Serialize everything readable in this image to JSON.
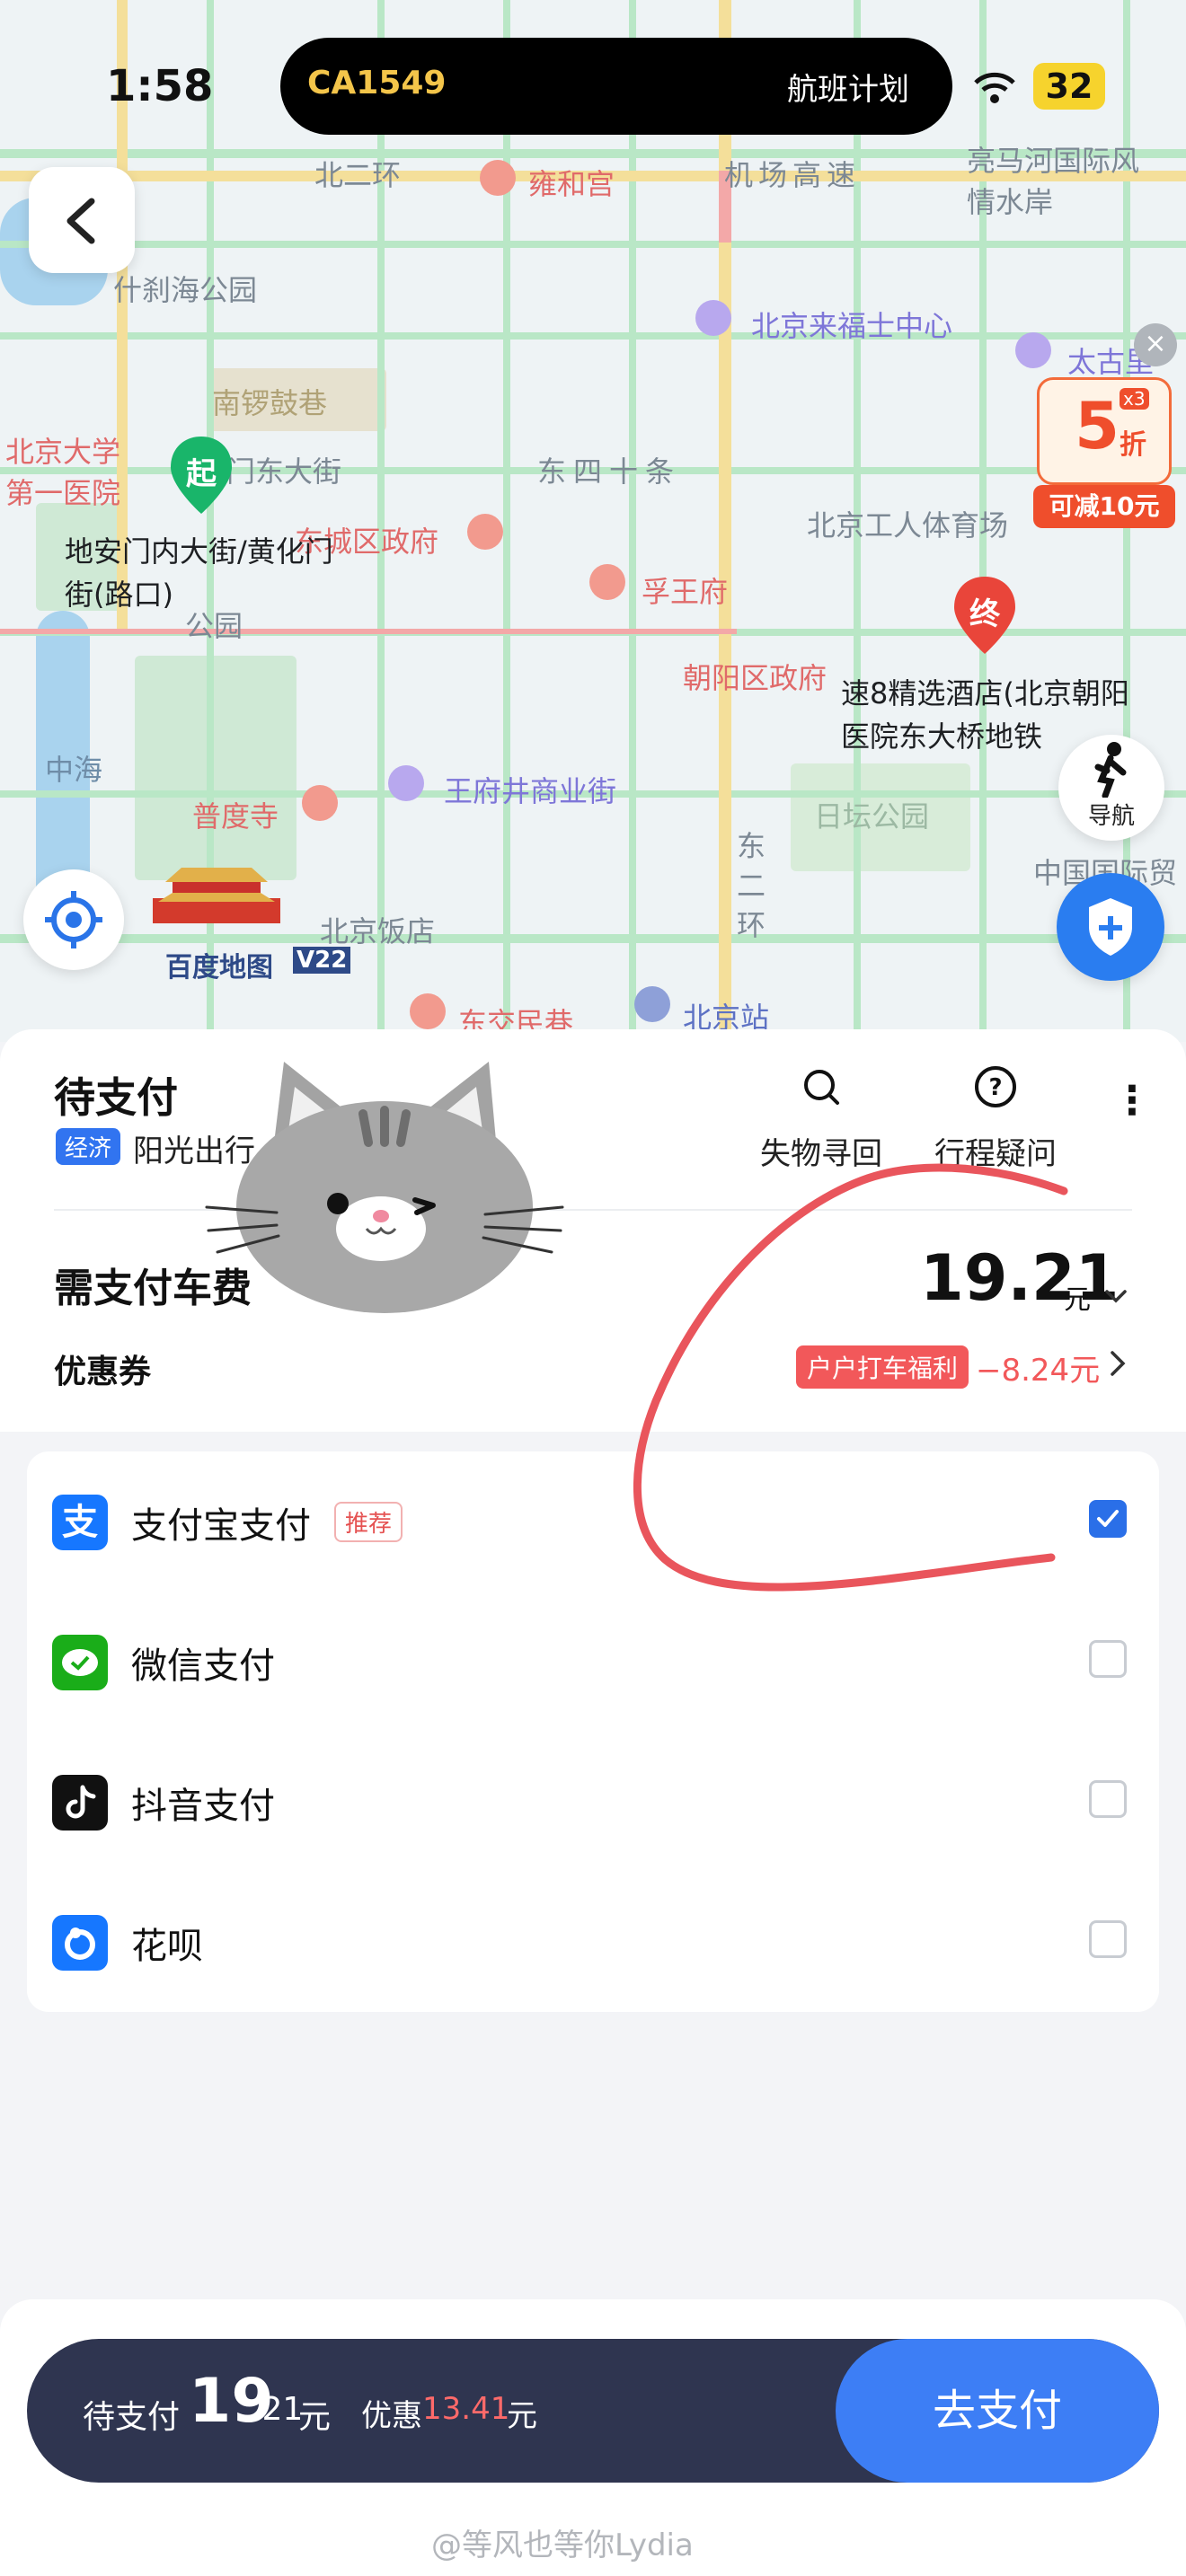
{
  "status_bar": {
    "time": "1:58",
    "island": {
      "flight_code": "CA1549",
      "flight_plan": "航班计划"
    },
    "battery": "32"
  },
  "map": {
    "labels": {
      "n2ring": "北二环",
      "yonghegong": "雍和宫",
      "airport_exp": "机场高速",
      "liangmahe": "亮马河国际风情水岸",
      "shichahai": "什刹海公园",
      "laifushi": "北京来福士中心",
      "taigu": "太古里",
      "nanluoguxiang": "南锣鼓巷",
      "pku_hospital": "北京大学第一医院",
      "dmen_east": "门东大街",
      "dongsi": "东四十条",
      "workers_stadium": "北京工人体育场",
      "dongcheng_gov": "东城区政府",
      "fuwangfu": "孚王府",
      "chaoyang_gov": "朝阳区政府",
      "park_label": "公园",
      "zhonghai": "中海",
      "putuo": "普度寺",
      "wangfujing": "王府井商业街",
      "ritan": "日坛公园",
      "e2ring": "东二环",
      "bj_hotel": "北京饭店",
      "dongjiaominxiang": "东交民巷",
      "bj_station": "北京站",
      "china_intl": "中国国际贸",
      "brand": "百度地图",
      "brand_ver": "V22",
      "promo_discount": "5",
      "promo_unit": "折",
      "promo_mult": "x3",
      "promo_save": "可减10元",
      "close": "×"
    },
    "start_badge": "起",
    "start_label": "地安门内大街/黄化门街(路口)",
    "end_badge": "终",
    "end_label": "速8精选酒店(北京朝阳医院东大桥地铁",
    "nav_label": "导航"
  },
  "order": {
    "status": "待支付",
    "ride_type": "经济",
    "provider": "阳光出行",
    "actions": [
      {
        "label": "失物寻回",
        "icon": "search-icon"
      },
      {
        "label": "行程疑问",
        "icon": "question-icon"
      }
    ],
    "more": "⋮",
    "fare_label": "需支付车费",
    "fare_amount": "19.21",
    "fare_unit": "元",
    "coupon_label": "优惠券",
    "coupon_tag": "户户打车福利",
    "coupon_value": "−8.24元"
  },
  "payment_methods": [
    {
      "label": "支付宝支付",
      "badge": "推荐",
      "checked": true,
      "icon": "alipay-icon",
      "color": "#1677ff"
    },
    {
      "label": "微信支付",
      "checked": false,
      "icon": "wechat-pay-icon",
      "color": "#1aad19"
    },
    {
      "label": "抖音支付",
      "checked": false,
      "icon": "douyin-pay-icon",
      "color": "#111111"
    },
    {
      "label": "花呗",
      "checked": false,
      "icon": "huabei-icon",
      "color": "#1677ff"
    }
  ],
  "bottom_bar": {
    "label": "待支付",
    "amount_int": "19",
    "amount_dec": ".21",
    "unit": "元",
    "discount_label": "优惠",
    "discount_value": "13.41",
    "discount_unit": "元",
    "pay_button": "去支付"
  },
  "watermark": "@等风也等你Lydia"
}
